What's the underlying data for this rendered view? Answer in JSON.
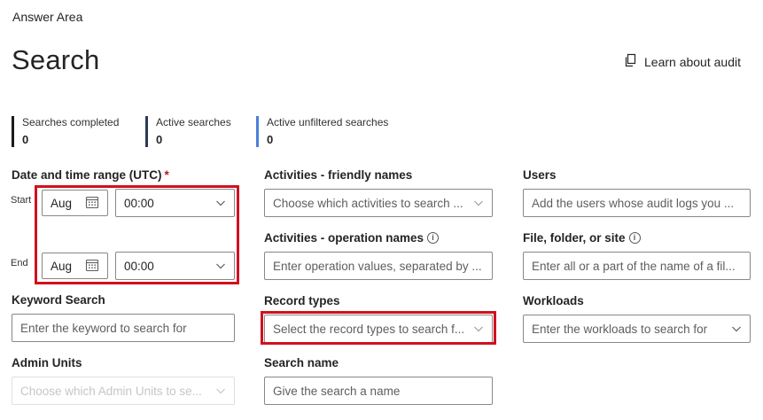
{
  "header": {
    "answer_area": "Answer Area",
    "title": "Search",
    "learn_link": "Learn about audit",
    "learn_icon": "document-copy-icon"
  },
  "stats": [
    {
      "label": "Searches completed",
      "value": "0",
      "color": "#1b1b1b"
    },
    {
      "label": "Active searches",
      "value": "0",
      "color": "#2b3a55"
    },
    {
      "label": "Active unfiltered searches",
      "value": "0",
      "color": "#4a7fd6"
    }
  ],
  "date_range": {
    "label": "Date and time range (UTC)",
    "required_mark": "*",
    "start_label": "Start",
    "end_label": "End",
    "start_date": "Aug",
    "start_time": "00:00",
    "end_date": "Aug",
    "end_time": "00:00"
  },
  "activities_friendly": {
    "label": "Activities - friendly names",
    "placeholder": "Choose which activities to search ..."
  },
  "users": {
    "label": "Users",
    "placeholder": "Add the users whose audit logs you ..."
  },
  "activities_operation": {
    "label": "Activities - operation names",
    "placeholder": "Enter operation values, separated by ..."
  },
  "file_folder": {
    "label": "File, folder, or site",
    "placeholder": "Enter all or a part of the name of a fil..."
  },
  "keyword": {
    "label": "Keyword Search",
    "placeholder": "Enter the keyword to search for"
  },
  "record_types": {
    "label": "Record types",
    "placeholder": "Select the record types to search f..."
  },
  "workloads": {
    "label": "Workloads",
    "placeholder": "Enter the workloads to search for"
  },
  "admin_units": {
    "label": "Admin Units",
    "placeholder": "Choose which Admin Units to se..."
  },
  "search_name": {
    "label": "Search name",
    "placeholder": "Give the search a name"
  },
  "colors": {
    "highlight": "#d0111f",
    "required": "#c50f1f"
  }
}
